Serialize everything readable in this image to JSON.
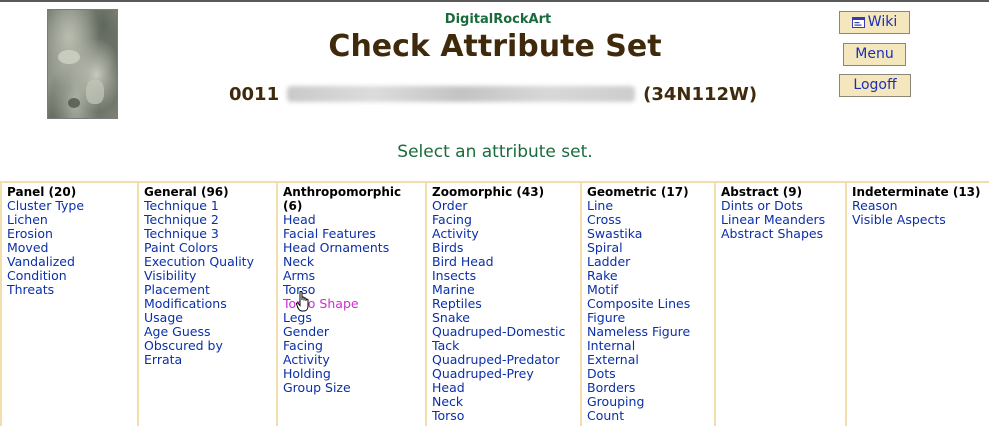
{
  "header": {
    "brand": "DigitalRockArt",
    "title": "Check Attribute Set",
    "site_code": "0011",
    "site_coords": "(34N112W)"
  },
  "nav": {
    "wiki_label": "Wiki",
    "menu_label": "Menu",
    "logoff_label": "Logoff"
  },
  "prompt": "Select an attribute set.",
  "columns": [
    {
      "header": "Panel (20)",
      "items": [
        "Cluster Type",
        "Lichen",
        "Erosion",
        "Moved",
        "Vandalized",
        "Condition",
        "Threats"
      ]
    },
    {
      "header": "General (96)",
      "items": [
        "Technique 1",
        "Technique 2",
        "Technique 3",
        "Paint Colors",
        "Execution Quality",
        "Visibility",
        "Placement",
        "Modifications",
        "Usage",
        "Age Guess",
        "Obscured by",
        "Errata"
      ]
    },
    {
      "header": "Anthropomorphic (6)",
      "items": [
        "Head",
        "Facial Features",
        "Head Ornaments",
        "Neck",
        "Arms",
        "Torso",
        "Torso Shape",
        "Legs",
        "Gender",
        "Facing",
        "Activity",
        "Holding",
        "Group Size"
      ]
    },
    {
      "header": "Zoomorphic (43)",
      "items": [
        "Order",
        "Facing",
        "Activity",
        "Birds",
        "Bird Head",
        "Insects",
        "Marine",
        "Reptiles",
        "Snake",
        "Quadruped-Domestic",
        "Tack",
        "Quadruped-Predator",
        "Quadruped-Prey",
        "Head",
        "Neck",
        "Torso"
      ]
    },
    {
      "header": "Geometric (17)",
      "items": [
        "Line",
        "Cross",
        "Swastika",
        "Spiral",
        "Ladder",
        "Rake",
        "Motif",
        "Composite Lines",
        "Figure",
        "Nameless Figure",
        "Internal",
        "External",
        "Dots",
        "Borders",
        "Grouping",
        "Count"
      ]
    },
    {
      "header": "Abstract (9)",
      "items": [
        "Dints or Dots",
        "Linear Meanders",
        "Abstract Shapes"
      ]
    },
    {
      "header": "Indeterminate (13)",
      "items": [
        "Reason",
        "Visible Aspects"
      ]
    }
  ],
  "colors": {
    "brand_green": "#1a6b3c",
    "title_brown": "#3f2a0c",
    "link_blue": "#0b2fa8",
    "hover_magenta": "#d12ad1",
    "grid_tan": "#f1deac",
    "button_bg": "#f5e7bd"
  }
}
